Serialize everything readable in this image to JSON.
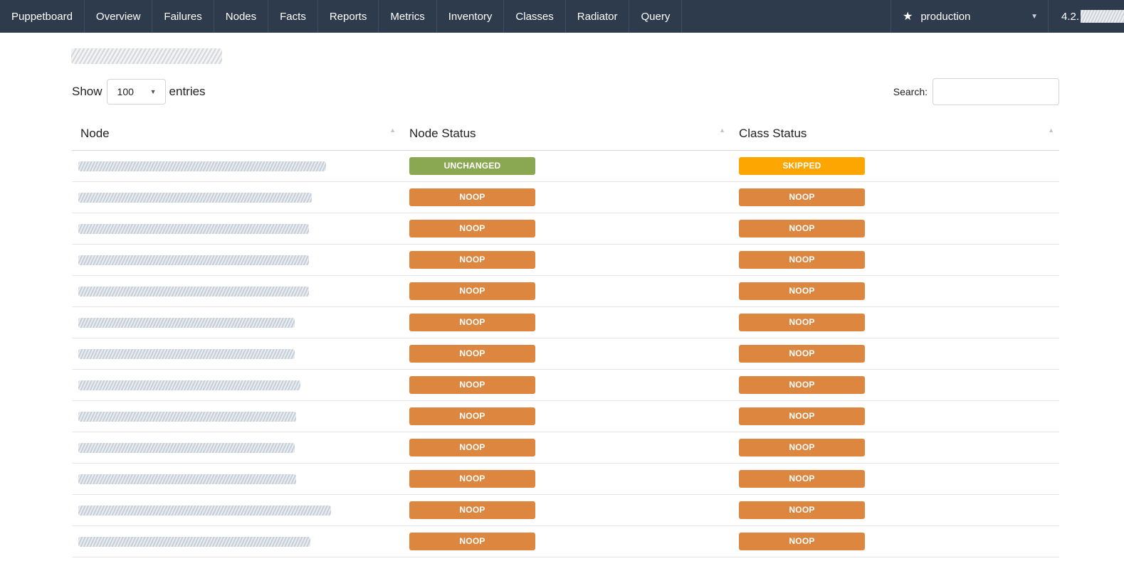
{
  "nav": {
    "items": [
      "Puppetboard",
      "Overview",
      "Failures",
      "Nodes",
      "Facts",
      "Reports",
      "Metrics",
      "Inventory",
      "Classes",
      "Radiator",
      "Query"
    ],
    "environment": "production",
    "version": "4.2."
  },
  "controls": {
    "show_label": "Show",
    "entries_value": "100",
    "entries_label": "entries",
    "search_label": "Search:",
    "search_value": ""
  },
  "table": {
    "headers": [
      "Node",
      "Node Status",
      "Class Status"
    ],
    "rows": [
      {
        "node_status": "UNCHANGED",
        "class_status": "SKIPPED"
      },
      {
        "node_status": "NOOP",
        "class_status": "NOOP"
      },
      {
        "node_status": "NOOP",
        "class_status": "NOOP"
      },
      {
        "node_status": "NOOP",
        "class_status": "NOOP"
      },
      {
        "node_status": "NOOP",
        "class_status": "NOOP"
      },
      {
        "node_status": "NOOP",
        "class_status": "NOOP"
      },
      {
        "node_status": "NOOP",
        "class_status": "NOOP"
      },
      {
        "node_status": "NOOP",
        "class_status": "NOOP"
      },
      {
        "node_status": "NOOP",
        "class_status": "NOOP"
      },
      {
        "node_status": "NOOP",
        "class_status": "NOOP"
      },
      {
        "node_status": "NOOP",
        "class_status": "NOOP"
      },
      {
        "node_status": "NOOP",
        "class_status": "NOOP"
      },
      {
        "node_status": "NOOP",
        "class_status": "NOOP"
      }
    ]
  },
  "colors": {
    "navbar": "#2d3b4c",
    "UNCHANGED": "#8aa852",
    "SKIPPED": "#fda500",
    "NOOP": "#dd863f"
  },
  "icons": {
    "environment": "star-icon",
    "dropdown": "caret-down-icon",
    "sort": "sort-asc-icon"
  }
}
